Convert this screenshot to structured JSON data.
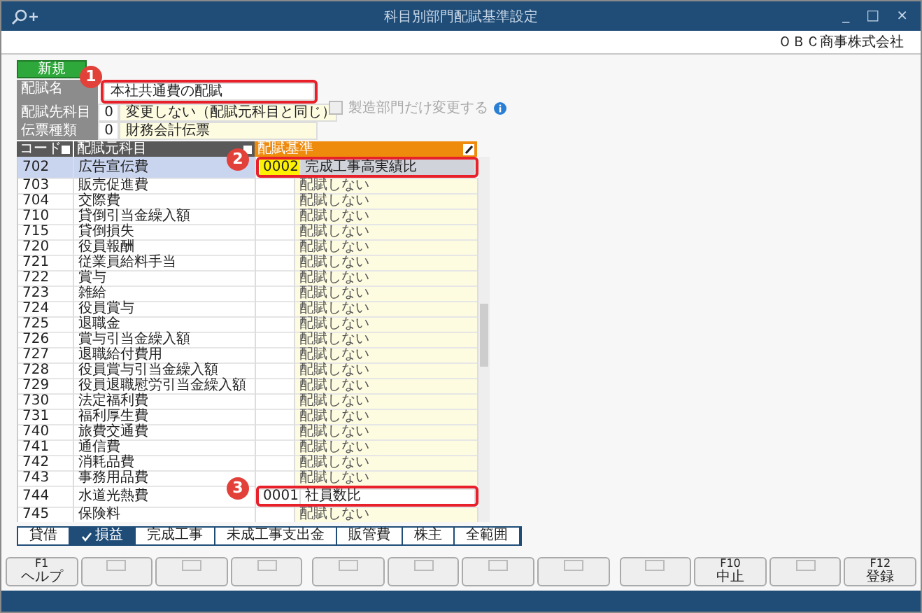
{
  "window": {
    "title": "科目別部門配賦基準設定",
    "controls": [
      "_",
      "□",
      "×"
    ]
  },
  "company": "ＯＢＣ商事株式会社",
  "new_button": "新規",
  "fields": [
    {
      "label": "配賦名",
      "value": "本社共通費の配賦"
    },
    {
      "label": "配賦先科目",
      "code": "0",
      "value": "変更しない（配賦元科目と同じ）"
    },
    {
      "label": "伝票種類",
      "code": "0",
      "value": "財務会計伝票"
    }
  ],
  "option": {
    "label": "製造部門だけ変更する",
    "checked": false,
    "disabled": true
  },
  "grid": {
    "columns": [
      "コード",
      "配賦元科目",
      "配賦基準"
    ],
    "rows": [
      {
        "code": "702",
        "name": "広告宣伝費",
        "basis_code": "0002",
        "basis": "完成工事高実績比",
        "selected": true
      },
      {
        "code": "703",
        "name": "販売促進費",
        "basis": "配賦しない",
        "selected": false
      },
      {
        "code": "704",
        "name": "交際費",
        "basis": "配賦しない",
        "selected": false
      },
      {
        "code": "710",
        "name": "貸倒引当金繰入額",
        "basis": "配賦しない",
        "selected": false
      },
      {
        "code": "715",
        "name": "貸倒損失",
        "basis": "配賦しない",
        "selected": false
      },
      {
        "code": "720",
        "name": "役員報酬",
        "basis": "配賦しない",
        "selected": false
      },
      {
        "code": "721",
        "name": "従業員給料手当",
        "basis": "配賦しない",
        "selected": false
      },
      {
        "code": "722",
        "name": "賞与",
        "basis": "配賦しない",
        "selected": false
      },
      {
        "code": "723",
        "name": "雑給",
        "basis": "配賦しない",
        "selected": false
      },
      {
        "code": "724",
        "name": "役員賞与",
        "basis": "配賦しない",
        "selected": false
      },
      {
        "code": "725",
        "name": "退職金",
        "basis": "配賦しない",
        "selected": false
      },
      {
        "code": "726",
        "name": "賞与引当金繰入額",
        "basis": "配賦しない",
        "selected": false
      },
      {
        "code": "727",
        "name": "退職給付費用",
        "basis": "配賦しない",
        "selected": false
      },
      {
        "code": "728",
        "name": "役員賞与引当金繰入額",
        "basis": "配賦しない",
        "selected": false
      },
      {
        "code": "729",
        "name": "役員退職慰労引当金繰入額",
        "basis": "配賦しない",
        "selected": false
      },
      {
        "code": "730",
        "name": "法定福利費",
        "basis": "配賦しない",
        "selected": false
      },
      {
        "code": "731",
        "name": "福利厚生費",
        "basis": "配賦しない",
        "selected": false
      },
      {
        "code": "740",
        "name": "旅費交通費",
        "basis": "配賦しない",
        "selected": false
      },
      {
        "code": "741",
        "name": "通信費",
        "basis": "配賦しない",
        "selected": false
      },
      {
        "code": "742",
        "name": "消耗品費",
        "basis": "配賦しない",
        "selected": false
      },
      {
        "code": "743",
        "name": "事務用品費",
        "basis": "配賦しない",
        "selected": false
      },
      {
        "code": "744",
        "name": "水道光熱費",
        "basis_code": "0001",
        "basis": "社員数比",
        "selected": false
      },
      {
        "code": "745",
        "name": "保険料",
        "basis": "配賦しない",
        "selected": false
      }
    ]
  },
  "tabs": [
    {
      "label": "貸借",
      "selected": false
    },
    {
      "label": "損益",
      "selected": true
    },
    {
      "label": "完成工事",
      "selected": false
    },
    {
      "label": "未成工事支出金",
      "selected": false
    },
    {
      "label": "販管費",
      "selected": false
    },
    {
      "label": "株主",
      "selected": false
    },
    {
      "label": "全範囲",
      "selected": false
    }
  ],
  "function_keys": [
    {
      "kind": "labeled",
      "key": "F1",
      "label": "ヘルプ"
    },
    {
      "kind": "blank"
    },
    {
      "kind": "blank"
    },
    {
      "kind": "blank"
    },
    {
      "kind": "blank"
    },
    {
      "kind": "blank"
    },
    {
      "kind": "blank"
    },
    {
      "kind": "blank"
    },
    {
      "kind": "blank"
    },
    {
      "kind": "labeled",
      "key": "F10",
      "label": "中止"
    },
    {
      "kind": "blank"
    },
    {
      "kind": "labeled",
      "key": "F12",
      "label": "登録"
    }
  ],
  "callouts": [
    {
      "number": "1"
    },
    {
      "number": "2"
    },
    {
      "number": "3"
    }
  ]
}
